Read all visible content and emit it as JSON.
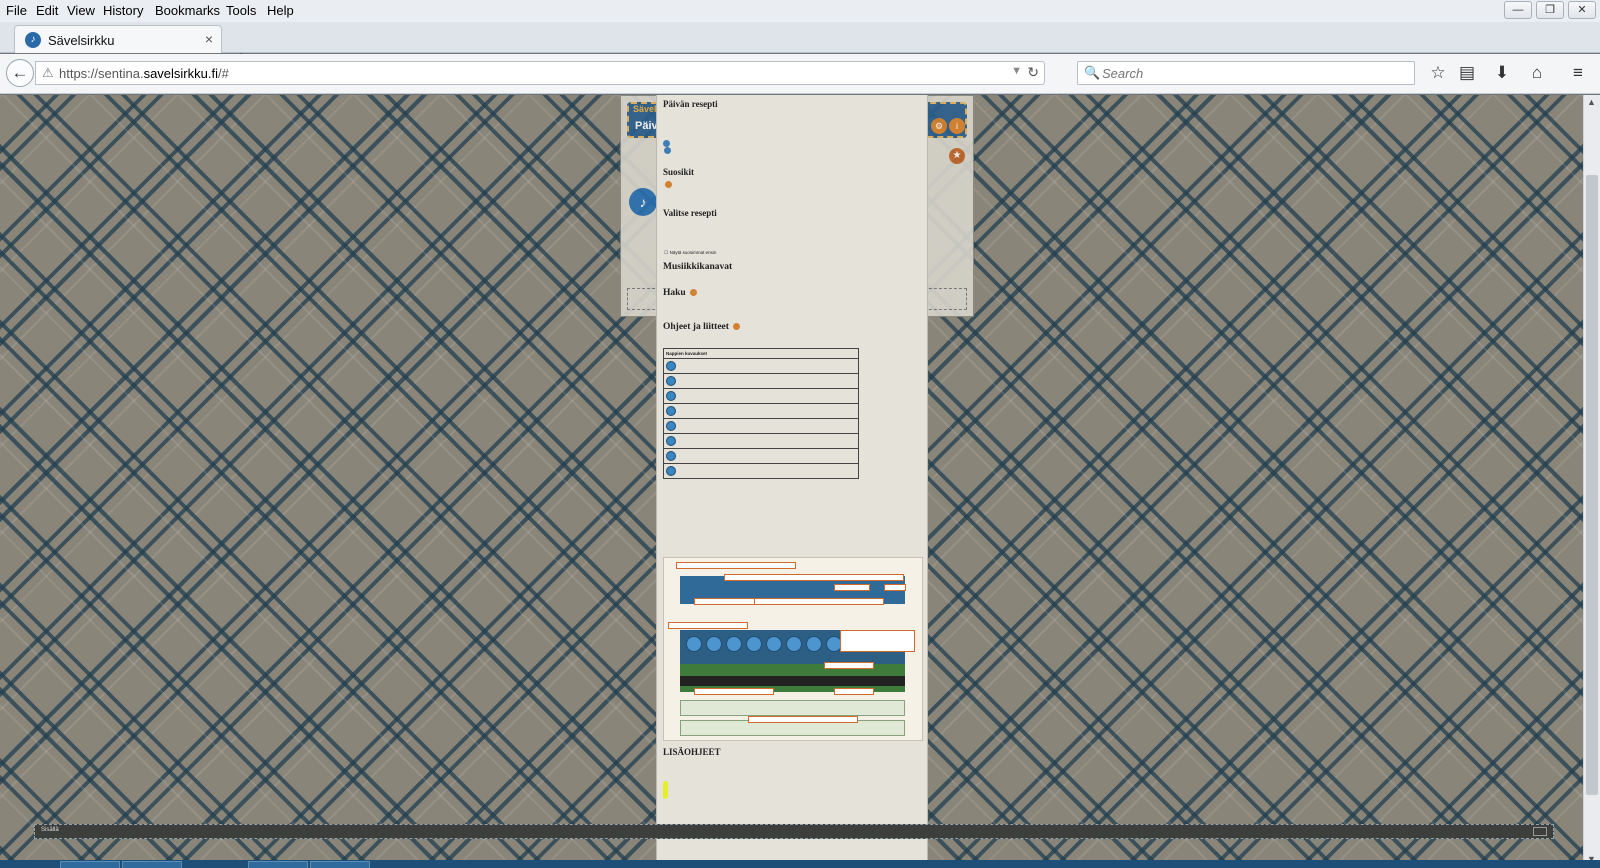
{
  "menubar": {
    "items": [
      "File",
      "Edit",
      "View",
      "History",
      "Bookmarks",
      "Tools",
      "Help"
    ]
  },
  "window_controls": [
    "—",
    "❐",
    "✕"
  ],
  "tab": {
    "title": "Sävelsirkku",
    "close": "×",
    "new_tab": "+"
  },
  "navbar": {
    "url_prefix": "https://sentina.",
    "url_domain": "savelsirkku.fi",
    "url_suffix": "/#",
    "search_placeholder": "Search"
  },
  "app": {
    "header_small": "Sävelsirkku",
    "header_title": "Päivän"
  },
  "help": {
    "sections": {
      "recipe": "Päivän resepti",
      "favorites": "Suosikit",
      "choose": "Valitse resepti",
      "channels": "Musiikkikanavat",
      "search": "Haku",
      "guides": "Ohjeet ja liitteet",
      "more": "LISÄOHJEET"
    },
    "checkbox_label": "Näytä suosimmat ensin",
    "table_header": "Nappien kuvaukset"
  },
  "statusstrip": {
    "label": "Sisällä"
  }
}
